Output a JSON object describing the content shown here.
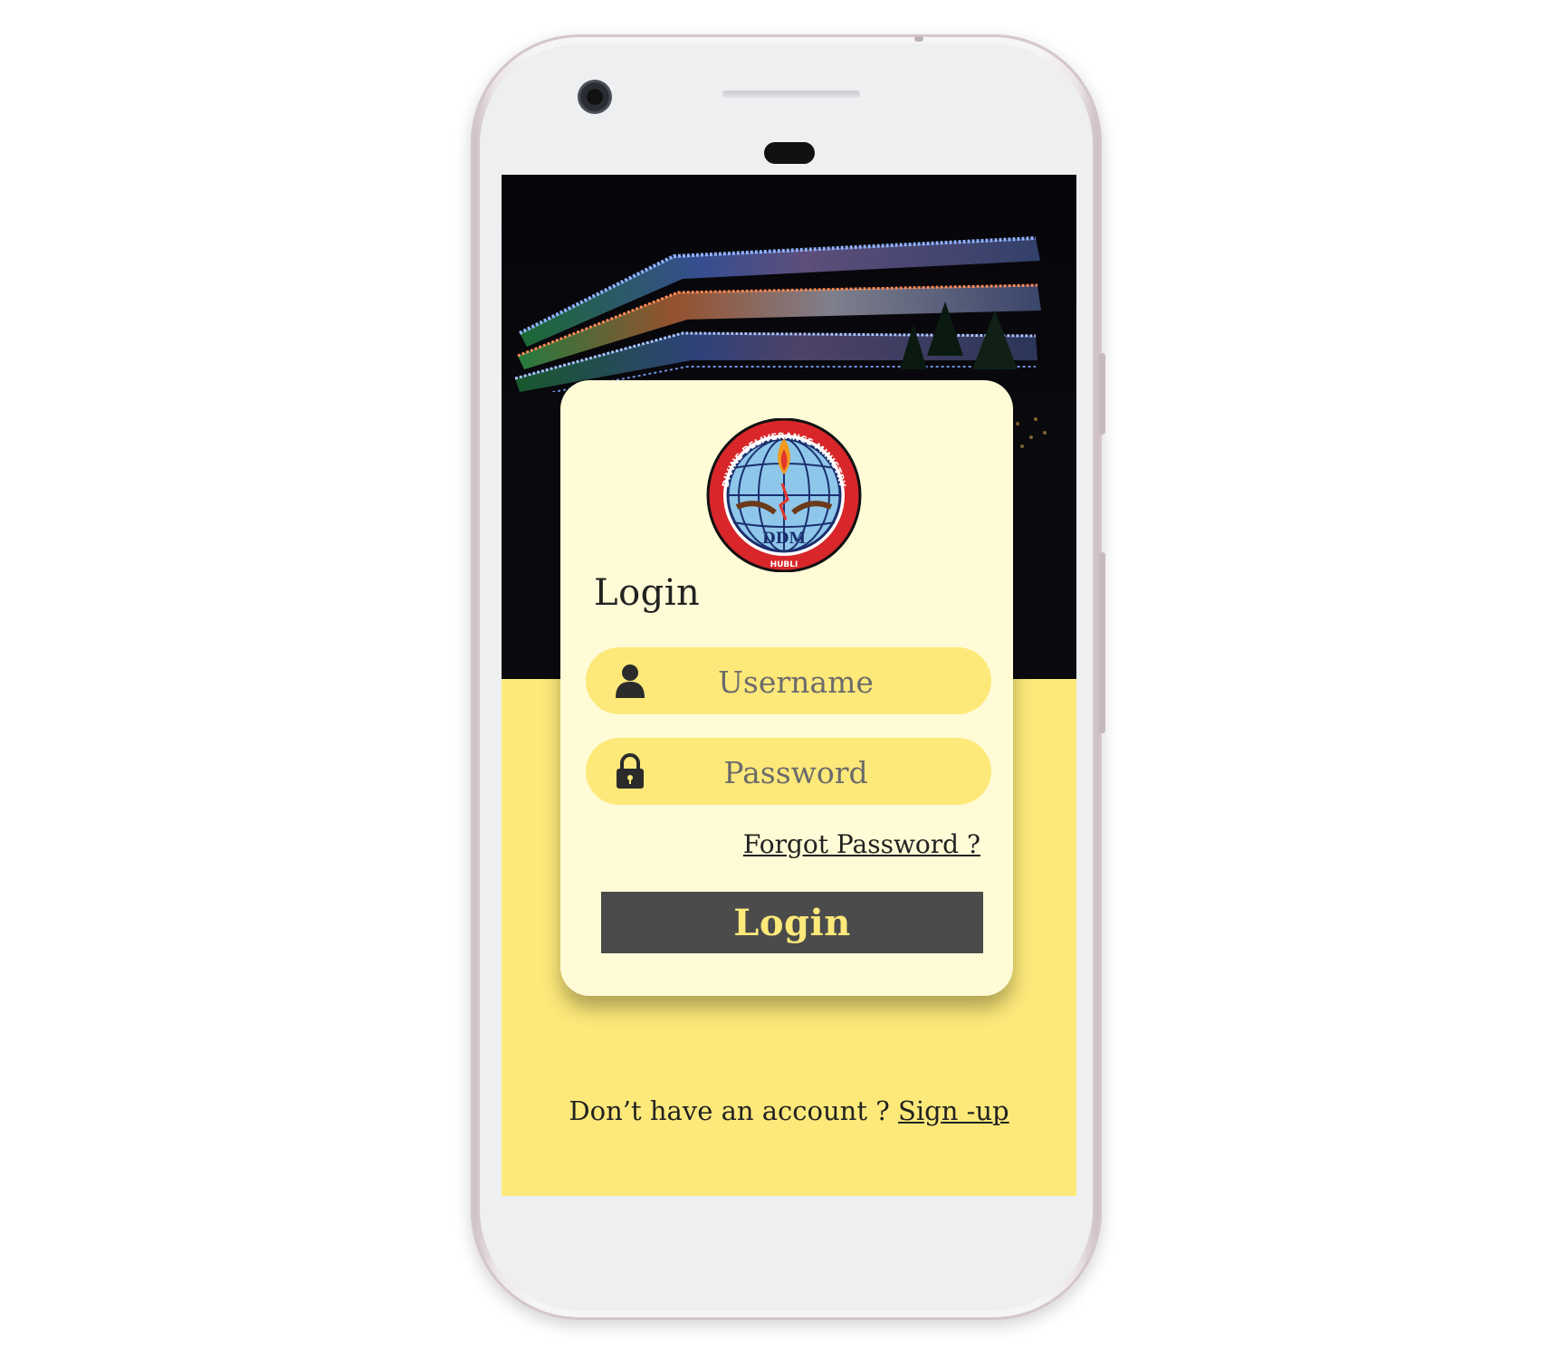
{
  "logo": {
    "ring_text": "DIVINE DELIVERANCE MINISTRY",
    "center_text": "DDM",
    "bottom_text": "HUBLI"
  },
  "login": {
    "title": "Login",
    "username_placeholder": "Username",
    "password_placeholder": "Password",
    "forgot_label": "Forgot Password ?",
    "button_label": "Login"
  },
  "footer": {
    "prompt": "Don’t have an account ? ",
    "signup_label": "Sign -up"
  },
  "icons": {
    "username": "user-icon",
    "password": "lock-icon"
  },
  "colors": {
    "accent_yellow": "#fde97a",
    "card_bg": "#fffbd6",
    "button_bg": "#4b4b4b"
  }
}
